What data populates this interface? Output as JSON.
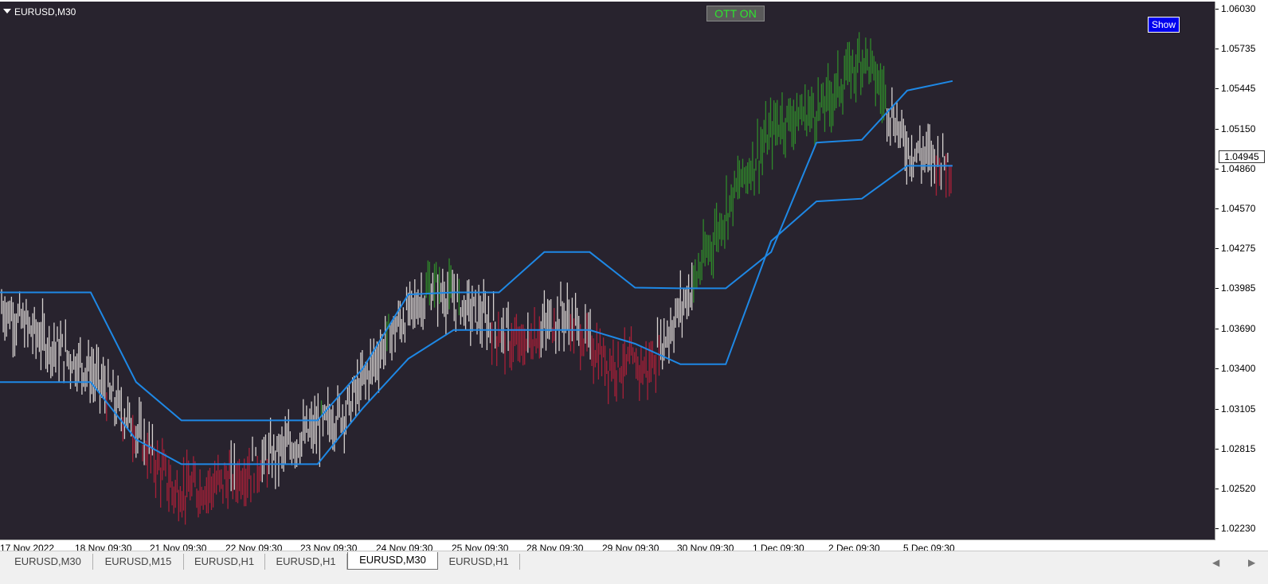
{
  "window": {
    "symbol_label": "EURUSD,M30"
  },
  "buttons": {
    "ott_label": "OTT ON",
    "show_label": "Show"
  },
  "colors": {
    "background": "#28232e",
    "bull": "#2f8a2a",
    "bear": "#a82038",
    "neutral": "#d6d2d0",
    "band": "#1e88e5",
    "ott_text": "#2ee52e",
    "show_bg": "#0000ee"
  },
  "price_axis": {
    "labels": [
      "1.06030",
      "1.05735",
      "1.05445",
      "1.05150",
      "1.04860",
      "1.04570",
      "1.04275",
      "1.03985",
      "1.03690",
      "1.03400",
      "1.03105",
      "1.02815",
      "1.02520",
      "1.02230"
    ],
    "current_price": "1.04945"
  },
  "time_axis": {
    "labels": [
      "17 Nov 2022",
      "18 Nov 09:30",
      "21 Nov 09:30",
      "22 Nov 09:30",
      "23 Nov 09:30",
      "24 Nov 09:30",
      "25 Nov 09:30",
      "28 Nov 09:30",
      "29 Nov 09:30",
      "30 Nov 09:30",
      "1 Dec 09:30",
      "2 Dec 09:30",
      "5 Dec 09:30"
    ]
  },
  "chart_data": {
    "type": "line",
    "title": "",
    "xlabel": "",
    "ylabel": "",
    "x": [
      "17 Nov 2022",
      "18 Nov 09:30",
      "19 Nov",
      "21 Nov 09:30",
      "21 Nov 18:00",
      "22 Nov 09:30",
      "22 Nov 18:00",
      "23 Nov 09:30",
      "23 Nov 18:00",
      "24 Nov 09:30",
      "25 Nov 09:30",
      "28 Nov 09:30",
      "28 Nov 18:00",
      "29 Nov 09:30",
      "29 Nov 18:00",
      "30 Nov 09:30",
      "1 Dec 09:30",
      "1 Dec 18:00",
      "2 Dec 09:30",
      "2 Dec 18:00",
      "5 Dec 09:30",
      "5 Dec 18:00"
    ],
    "ylim": [
      1.0215,
      1.0608
    ],
    "price_path": [
      1.0385,
      1.036,
      1.034,
      1.03,
      1.025,
      1.0255,
      1.027,
      1.029,
      1.031,
      1.0365,
      1.04,
      1.038,
      1.0355,
      1.038,
      1.0345,
      1.034,
      1.04,
      1.047,
      1.052,
      1.053,
      1.057,
      1.05,
      1.049
    ],
    "series": [
      {
        "name": "",
        "values": [
          1.03955,
          1.03955,
          1.03955,
          1.033,
          1.0302,
          1.0302,
          1.0302,
          1.0302,
          1.034,
          1.0394,
          1.03955,
          1.03955,
          1.0425,
          1.0425,
          1.0399,
          1.03985,
          1.03985,
          1.0425,
          1.0505,
          1.0507,
          1.0543,
          1.055
        ]
      },
      {
        "name": "",
        "values": [
          1.033,
          1.033,
          1.033,
          1.0288,
          1.027,
          1.027,
          1.027,
          1.027,
          1.0311,
          1.0347,
          1.0368,
          1.0368,
          1.0368,
          1.0368,
          1.0358,
          1.0343,
          1.0343,
          1.0433,
          1.0462,
          1.0464,
          1.0488,
          1.0488
        ]
      }
    ]
  }
}
